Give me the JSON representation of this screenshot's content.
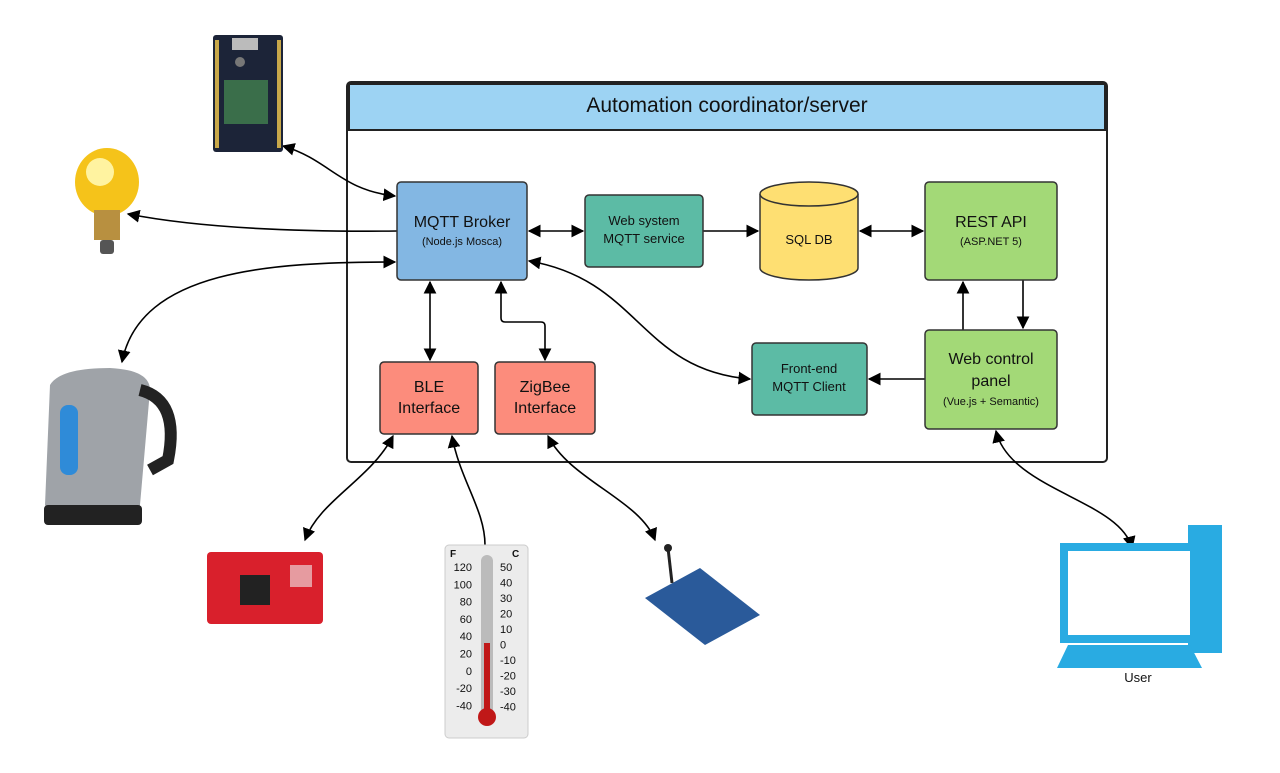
{
  "container": {
    "title": "Automation coordinator/server",
    "header_color": "#9dd3f3"
  },
  "nodes": {
    "mqtt_broker": {
      "title": "MQTT Broker",
      "subtitle": "(Node.js Mosca)",
      "color": "#83b7e3"
    },
    "web_system_mqtt": {
      "line1": "Web system",
      "line2": "MQTT service",
      "color": "#5cbba5"
    },
    "sql_db": {
      "title": "SQL DB",
      "color": "#fedf72"
    },
    "rest_api": {
      "title": "REST API",
      "subtitle": "(ASP.NET 5)",
      "color": "#a3d977"
    },
    "web_control_panel": {
      "line1": "Web control",
      "line2": "panel",
      "subtitle": "(Vue.js + Semantic)",
      "color": "#a3d977"
    },
    "frontend_mqtt": {
      "line1": "Front-end",
      "line2": "MQTT Client",
      "color": "#5cbba5"
    },
    "ble": {
      "line1": "BLE",
      "line2": "Interface",
      "color": "#fc8c7c"
    },
    "zigbee": {
      "line1": "ZigBee",
      "line2": "Interface",
      "color": "#fc8c7c"
    }
  },
  "devices": {
    "photon_board": "microcontroller-board",
    "light_bulb": "light-bulb",
    "kettle": "electric-kettle",
    "ble_board": "red-ble-board",
    "thermometer": {
      "f_label": "F",
      "c_label": "C",
      "f_ticks": [
        "120",
        "100",
        "80",
        "60",
        "40",
        "20",
        "0",
        "-20",
        "-40"
      ],
      "c_ticks": [
        "50",
        "40",
        "30",
        "20",
        "10",
        "0",
        "-10",
        "-20",
        "-30",
        "-40"
      ]
    },
    "xbee": "xbee-module",
    "computer": {
      "label": "User",
      "color": "#29abe2"
    }
  }
}
